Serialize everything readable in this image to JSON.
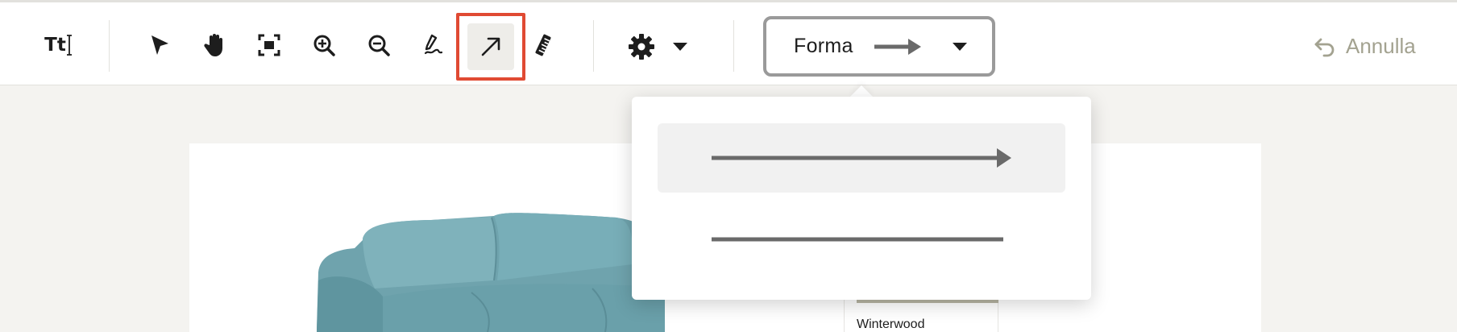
{
  "toolbar": {
    "text_tool": {
      "label": "Tt",
      "icon": "text-size-icon"
    },
    "tools": [
      {
        "icon": "cursor-arrow-icon"
      },
      {
        "icon": "hand-icon"
      },
      {
        "icon": "fit-screen-icon"
      },
      {
        "icon": "zoom-in-icon"
      },
      {
        "icon": "zoom-out-icon"
      },
      {
        "icon": "pen-icon"
      },
      {
        "icon": "arrow-tool-icon",
        "active": true
      },
      {
        "icon": "ruler-icon"
      }
    ],
    "settings": {
      "icon": "gear-icon",
      "dropdown_icon": "caret-down-icon"
    },
    "shape_select": {
      "label": "Forma",
      "value_icon": "arrow-line-icon",
      "dropdown_icon": "caret-down-icon"
    },
    "undo": {
      "label": "Annulla",
      "icon": "undo-icon"
    }
  },
  "shape_dropdown": {
    "options": [
      {
        "icon": "arrow-line-icon",
        "selected": true
      },
      {
        "icon": "plain-line-icon",
        "selected": false
      }
    ]
  },
  "canvas": {
    "swatch_name": "Winterwood"
  },
  "colors": {
    "active_outline": "#e04a33",
    "icon": "#1d1d1d",
    "line": "#6a6a6a",
    "muted_text": "#a3a290",
    "canvas_bg": "#f4f3f0"
  }
}
